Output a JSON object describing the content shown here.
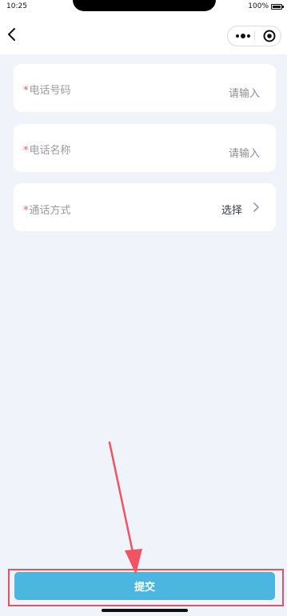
{
  "status_bar": {
    "time": "10:25",
    "battery": "100%"
  },
  "form": {
    "fields": [
      {
        "required_mark": "*",
        "label": "电话号码",
        "value": "请输入"
      },
      {
        "required_mark": "*",
        "label": "电话名称",
        "value": "请输入"
      },
      {
        "required_mark": "*",
        "label": "通话方式",
        "value": "选择"
      }
    ]
  },
  "footer": {
    "submit_label": "提交"
  },
  "colors": {
    "background": "#f1f3fa",
    "submit_button": "#4bb7e0",
    "required_mark": "#f25a5a",
    "annotation": "#e05566"
  },
  "icons": [
    "back-icon",
    "more-icon",
    "close-capsule-icon",
    "chevron-right-icon",
    "battery-icon"
  ]
}
